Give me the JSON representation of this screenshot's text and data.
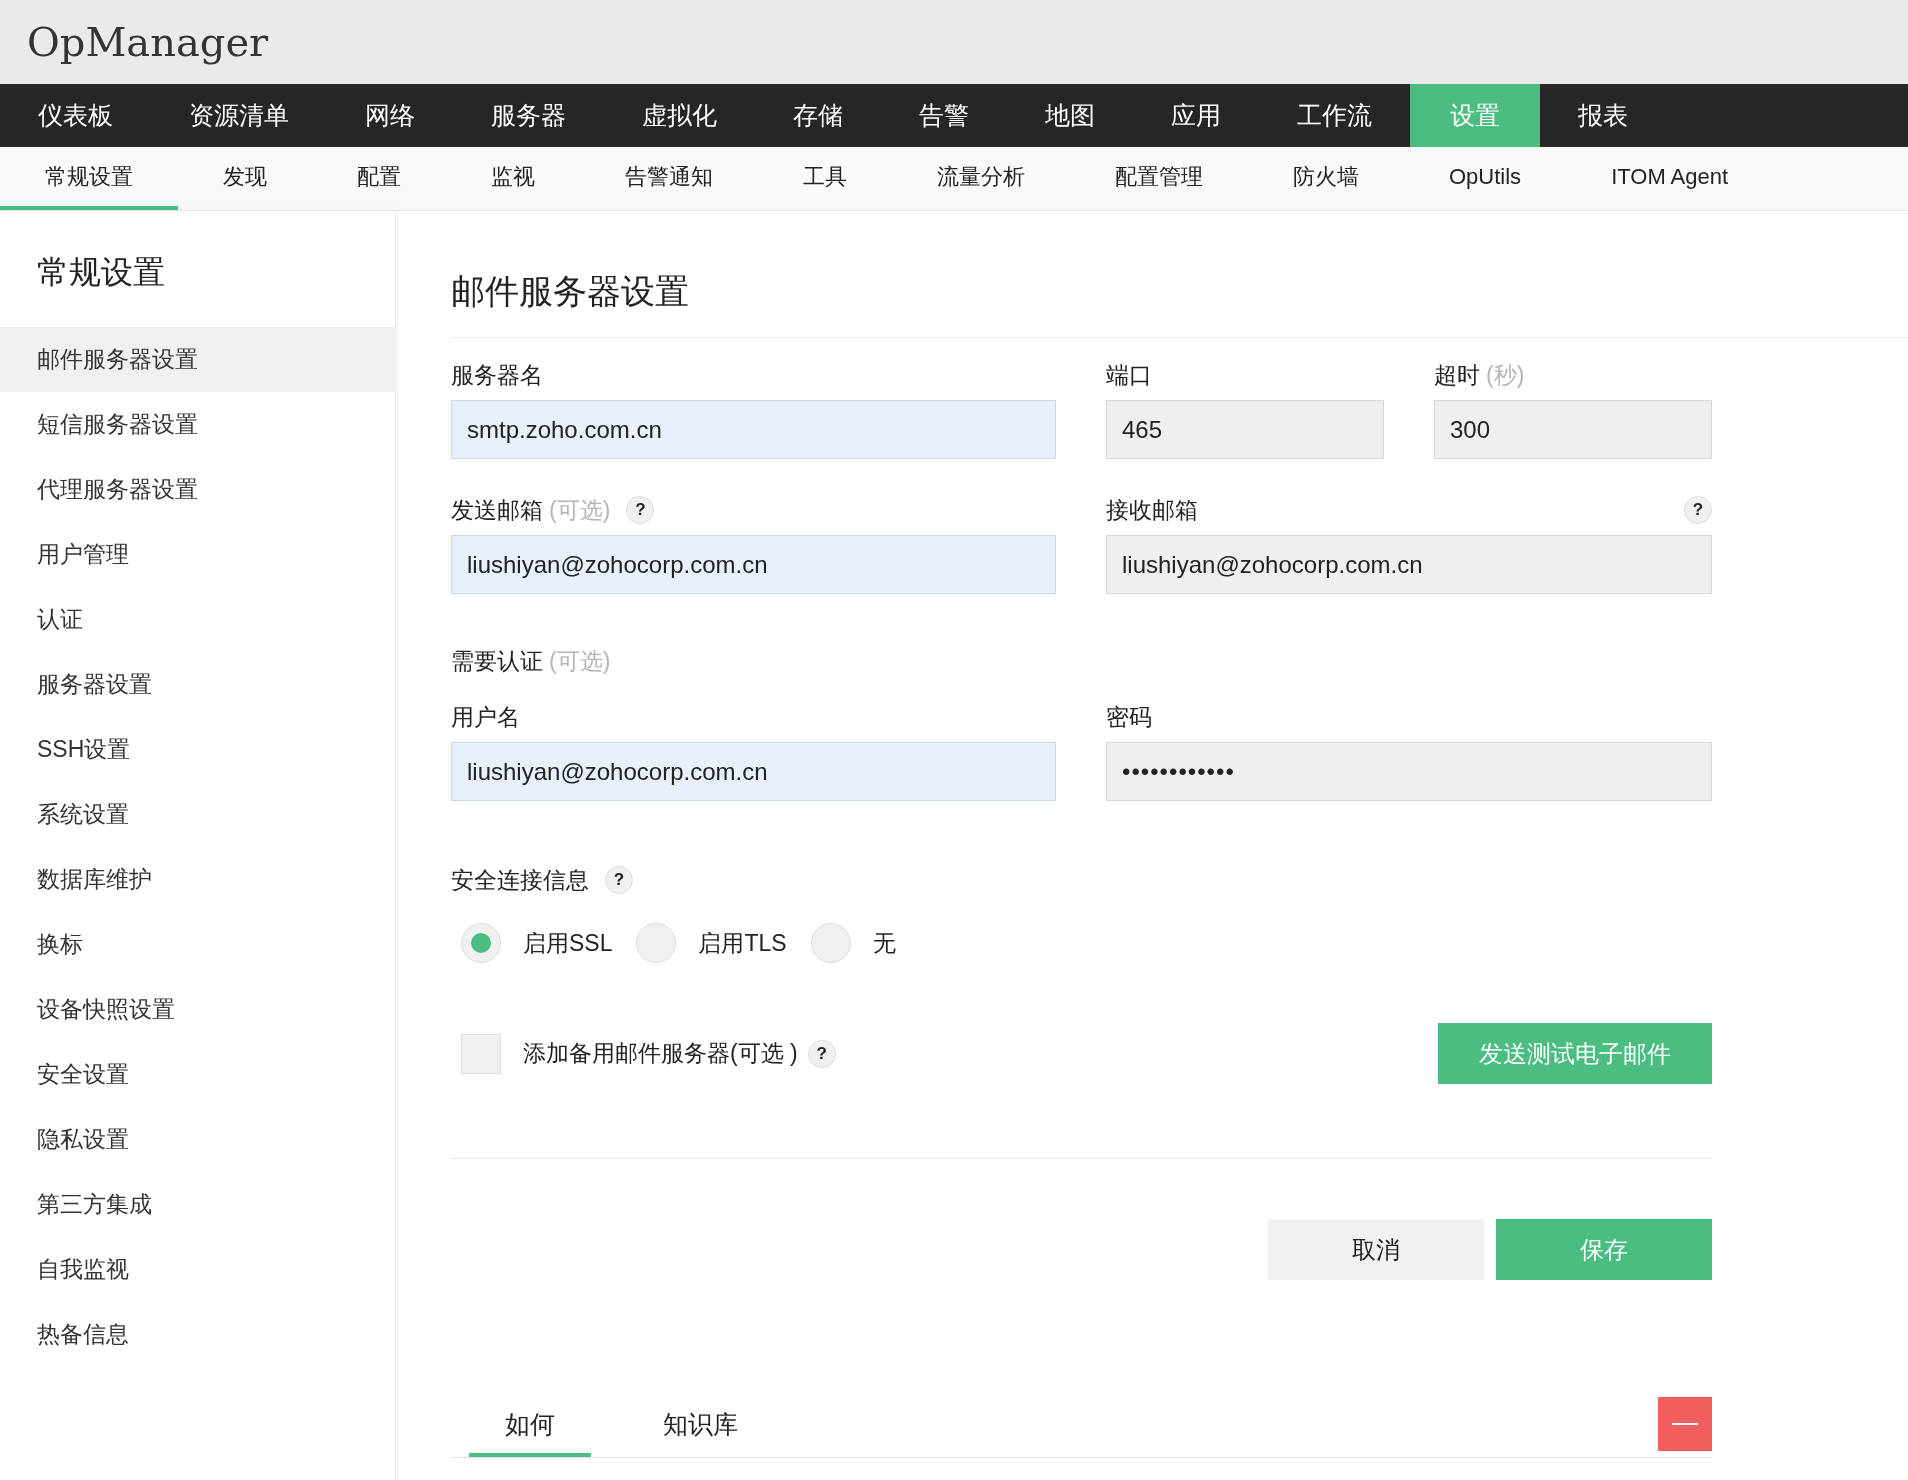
{
  "app": {
    "title": "OpManager"
  },
  "main_nav": [
    {
      "label": "仪表板",
      "selected": false
    },
    {
      "label": "资源清单",
      "selected": false
    },
    {
      "label": "网络",
      "selected": false
    },
    {
      "label": "服务器",
      "selected": false
    },
    {
      "label": "虚拟化",
      "selected": false
    },
    {
      "label": "存储",
      "selected": false
    },
    {
      "label": "告警",
      "selected": false
    },
    {
      "label": "地图",
      "selected": false
    },
    {
      "label": "应用",
      "selected": false
    },
    {
      "label": "工作流",
      "selected": false
    },
    {
      "label": "设置",
      "selected": true
    },
    {
      "label": "报表",
      "selected": false
    }
  ],
  "sub_nav": [
    {
      "label": "常规设置",
      "selected": true
    },
    {
      "label": "发现",
      "selected": false
    },
    {
      "label": "配置",
      "selected": false
    },
    {
      "label": "监视",
      "selected": false
    },
    {
      "label": "告警通知",
      "selected": false
    },
    {
      "label": "工具",
      "selected": false
    },
    {
      "label": "流量分析",
      "selected": false
    },
    {
      "label": "配置管理",
      "selected": false
    },
    {
      "label": "防火墙",
      "selected": false
    },
    {
      "label": "OpUtils",
      "selected": false
    },
    {
      "label": "ITOM Agent",
      "selected": false
    }
  ],
  "sidebar": {
    "title": "常规设置",
    "items": [
      {
        "label": "邮件服务器设置",
        "selected": true
      },
      {
        "label": "短信服务器设置",
        "selected": false
      },
      {
        "label": "代理服务器设置",
        "selected": false
      },
      {
        "label": "用户管理",
        "selected": false
      },
      {
        "label": "认证",
        "selected": false
      },
      {
        "label": "服务器设置",
        "selected": false
      },
      {
        "label": "SSH设置",
        "selected": false
      },
      {
        "label": "系统设置",
        "selected": false
      },
      {
        "label": "数据库维护",
        "selected": false
      },
      {
        "label": "换标",
        "selected": false
      },
      {
        "label": "设备快照设置",
        "selected": false
      },
      {
        "label": "安全设置",
        "selected": false
      },
      {
        "label": "隐私设置",
        "selected": false
      },
      {
        "label": "第三方集成",
        "selected": false
      },
      {
        "label": "自我监视",
        "selected": false
      },
      {
        "label": "热备信息",
        "selected": false
      }
    ]
  },
  "form": {
    "title": "邮件服务器设置",
    "server_name": {
      "label": "服务器名",
      "value": "smtp.zoho.com.cn"
    },
    "port": {
      "label": "端口",
      "value": "465"
    },
    "timeout": {
      "label": "超时",
      "hint": "(秒)",
      "value": "300"
    },
    "from_email": {
      "label": "发送邮箱",
      "hint": "(可选)",
      "help": "?",
      "value": "liushiyan@zohocorp.com.cn"
    },
    "to_email": {
      "label": "接收邮箱",
      "help": "?",
      "value": "liushiyan@zohocorp.com.cn"
    },
    "auth": {
      "label": "需要认证",
      "hint": "(可选)"
    },
    "username": {
      "label": "用户名",
      "value": "liushiyan@zohocorp.com.cn"
    },
    "password": {
      "label": "密码",
      "value": "••••••••••••"
    },
    "security": {
      "label": "安全连接信息",
      "help": "?",
      "options": [
        {
          "label": "启用SSL",
          "selected": true
        },
        {
          "label": "启用TLS",
          "selected": false
        },
        {
          "label": "无",
          "selected": false
        }
      ]
    },
    "backup": {
      "label": "添加备用邮件服务器(可选 )",
      "help": "?",
      "checked": false
    },
    "test_button": "发送测试电子邮件",
    "cancel_button": "取消",
    "save_button": "保存"
  },
  "help_tabs": [
    {
      "label": "如何",
      "selected": true
    },
    {
      "label": "知识库",
      "selected": false
    }
  ]
}
